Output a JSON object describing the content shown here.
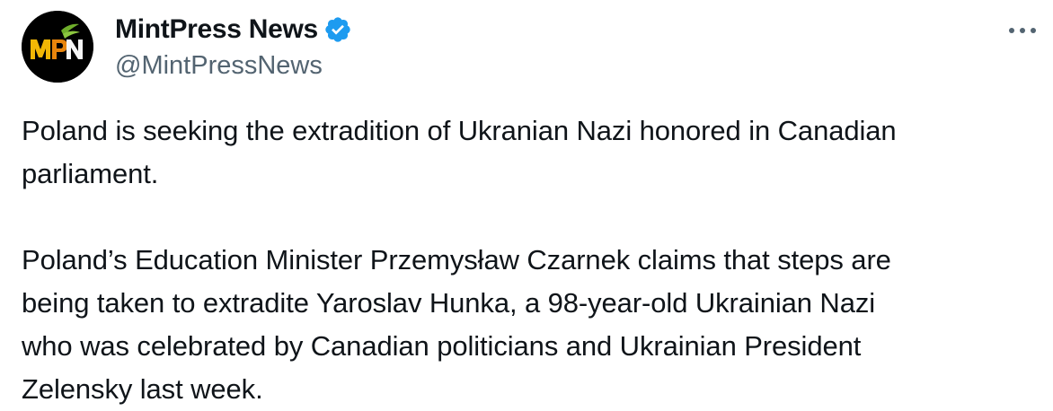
{
  "author": {
    "display_name": "MintPress News",
    "handle": "@MintPressNews",
    "avatar_text": "MPN",
    "verified": true
  },
  "tweet": {
    "text": "Poland is seeking the extradition of Ukranian Nazi honored in Canadian\nparliament.\n\nPoland’s Education Minister Przemysław Czarnek claims that steps are\nbeing taken to extradite Yaroslav Hunka, a 98-year-old Ukrainian Nazi\nwho was celebrated by Canadian politicians and Ukrainian President\nZelensky last week."
  },
  "icons": {
    "verified": "verified-badge-icon",
    "more": "more-options-icon"
  },
  "colors": {
    "text": "#0f1419",
    "secondary_text": "#536471",
    "verified_blue": "#1d9bf0",
    "avatar_bg": "#000000",
    "logo_yellow": "#f2b705",
    "logo_orange": "#e8850c",
    "logo_green": "#6fae2b"
  }
}
